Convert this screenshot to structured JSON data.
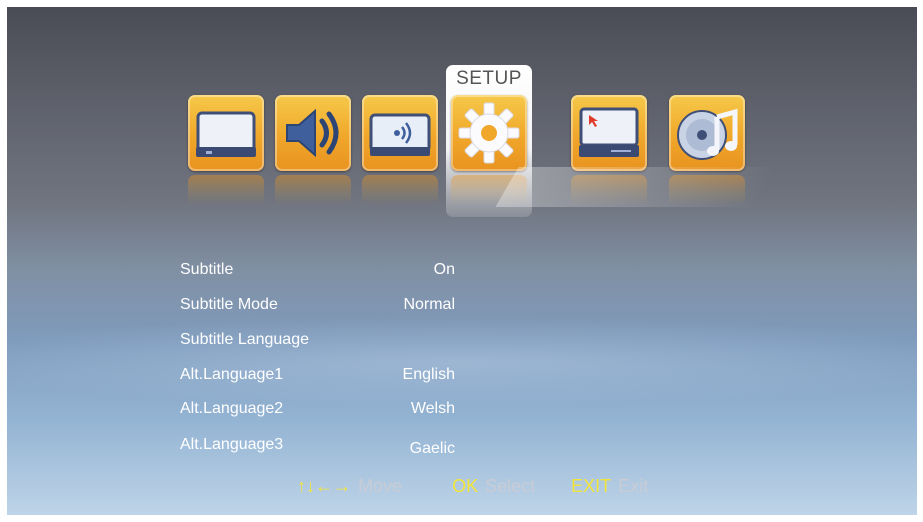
{
  "menu": {
    "items": [
      {
        "icon": "tv-icon",
        "selected": false
      },
      {
        "icon": "speaker-icon",
        "selected": false
      },
      {
        "icon": "media-icon",
        "selected": false
      },
      {
        "icon": "gear-icon",
        "selected": true,
        "label": "SETUP"
      },
      {
        "icon": "pc-icon",
        "selected": false
      },
      {
        "icon": "music-disc-icon",
        "selected": false
      }
    ],
    "selected_label": "SETUP",
    "accent": "#f0a72a"
  },
  "settings": [
    {
      "label": "Subtitle",
      "value": "On"
    },
    {
      "label": "Subtitle Mode",
      "value": "Normal"
    },
    {
      "label": "Subtitle Language",
      "value": ""
    },
    {
      "label": "Alt.Language1",
      "value": "English"
    },
    {
      "label": "Alt.Language2",
      "value": "Welsh"
    },
    {
      "label": "Alt.Language3",
      "value": "Gaelic"
    }
  ],
  "hints": {
    "move_key": "↑↓←→",
    "move_label": "Move",
    "ok_key": "OK",
    "ok_label": "Select",
    "exit_key": "EXIT",
    "exit_label": "Exit",
    "key_color": "#f2e53a"
  }
}
